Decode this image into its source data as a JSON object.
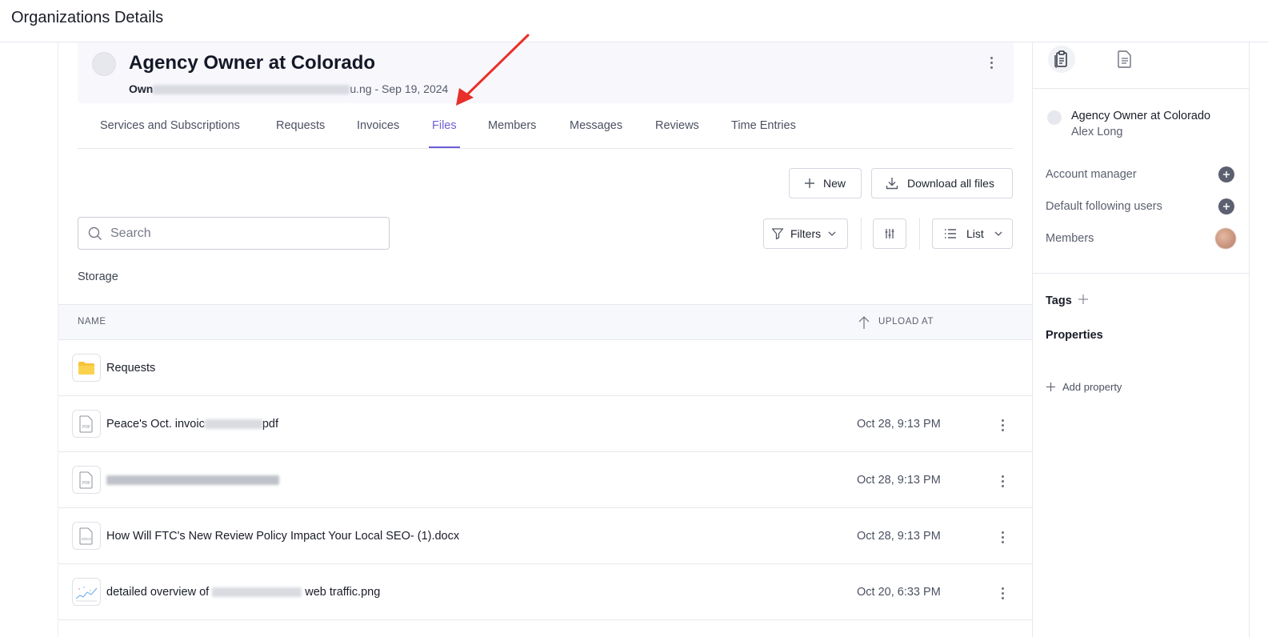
{
  "page_title": "Organizations Details",
  "org": {
    "name": "Agency Owner at Colorado",
    "sub_lead": "Own",
    "sub_tail": "u.ng - Sep 19, 2024"
  },
  "tabs": [
    {
      "label": "Services and Subscriptions"
    },
    {
      "label": "Requests"
    },
    {
      "label": "Invoices"
    },
    {
      "label": "Files"
    },
    {
      "label": "Members"
    },
    {
      "label": "Messages"
    },
    {
      "label": "Reviews"
    },
    {
      "label": "Time Entries"
    }
  ],
  "active_tab": "Files",
  "toolbar": {
    "new_label": "New",
    "download_label": "Download all files",
    "filters_label": "Filters",
    "view_label": "List"
  },
  "search": {
    "placeholder": "Search",
    "value": ""
  },
  "storage_label": "Storage",
  "table": {
    "col_name": "NAME",
    "col_upload": "UPLOAD AT",
    "rows": [
      {
        "type": "folder",
        "name_pre": "Requests",
        "name_post": "",
        "date": ""
      },
      {
        "type": "pdf",
        "name_pre": "Peace's Oct. invoic",
        "name_post": "pdf",
        "date": "Oct 28, 9:13 PM"
      },
      {
        "type": "pdf",
        "name_pre": "",
        "name_post": "",
        "date": "Oct 28, 9:13 PM"
      },
      {
        "type": "docx",
        "name_pre": "How Will FTC's New Review Policy Impact Your Local SEO- (1).docx",
        "name_post": "",
        "date": "Oct 28, 9:13 PM"
      },
      {
        "type": "png",
        "name_pre": "detailed overview of",
        "name_post": "web traffic.png",
        "date": "Oct 20, 6:33 PM"
      }
    ]
  },
  "sidebar": {
    "org_name": "Agency Owner at Colorado",
    "org_person": "Alex Long",
    "account_manager": "Account manager",
    "default_following": "Default following users",
    "members": "Members",
    "tags": "Tags",
    "properties": "Properties",
    "add_property": "Add property"
  },
  "colors": {
    "accent": "#6d5fd6",
    "annotation_arrow": "#e8302a",
    "folder": "#f8c33a"
  },
  "file_badges": {
    "pdf": "PDF",
    "docx": "DOCX"
  }
}
